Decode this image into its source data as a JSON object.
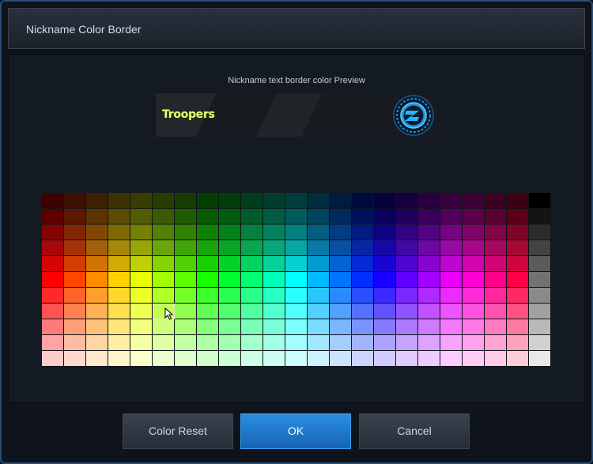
{
  "window": {
    "title": "Nickname Color Border"
  },
  "preview": {
    "caption": "Nickname text border color Preview",
    "nickname": "Troopers",
    "nickname_color": "#e8ff72",
    "badge_icon": "zb-emblem-icon"
  },
  "palette": {
    "rows": 11,
    "hue_columns": 22,
    "grayscale_column": true,
    "selected": {
      "row": 7,
      "column": 5
    }
  },
  "buttons": {
    "reset_label": "Color Reset",
    "ok_label": "OK",
    "cancel_label": "Cancel"
  },
  "colors": {
    "accent": "#1f7ad0",
    "background": "#0f141c"
  }
}
